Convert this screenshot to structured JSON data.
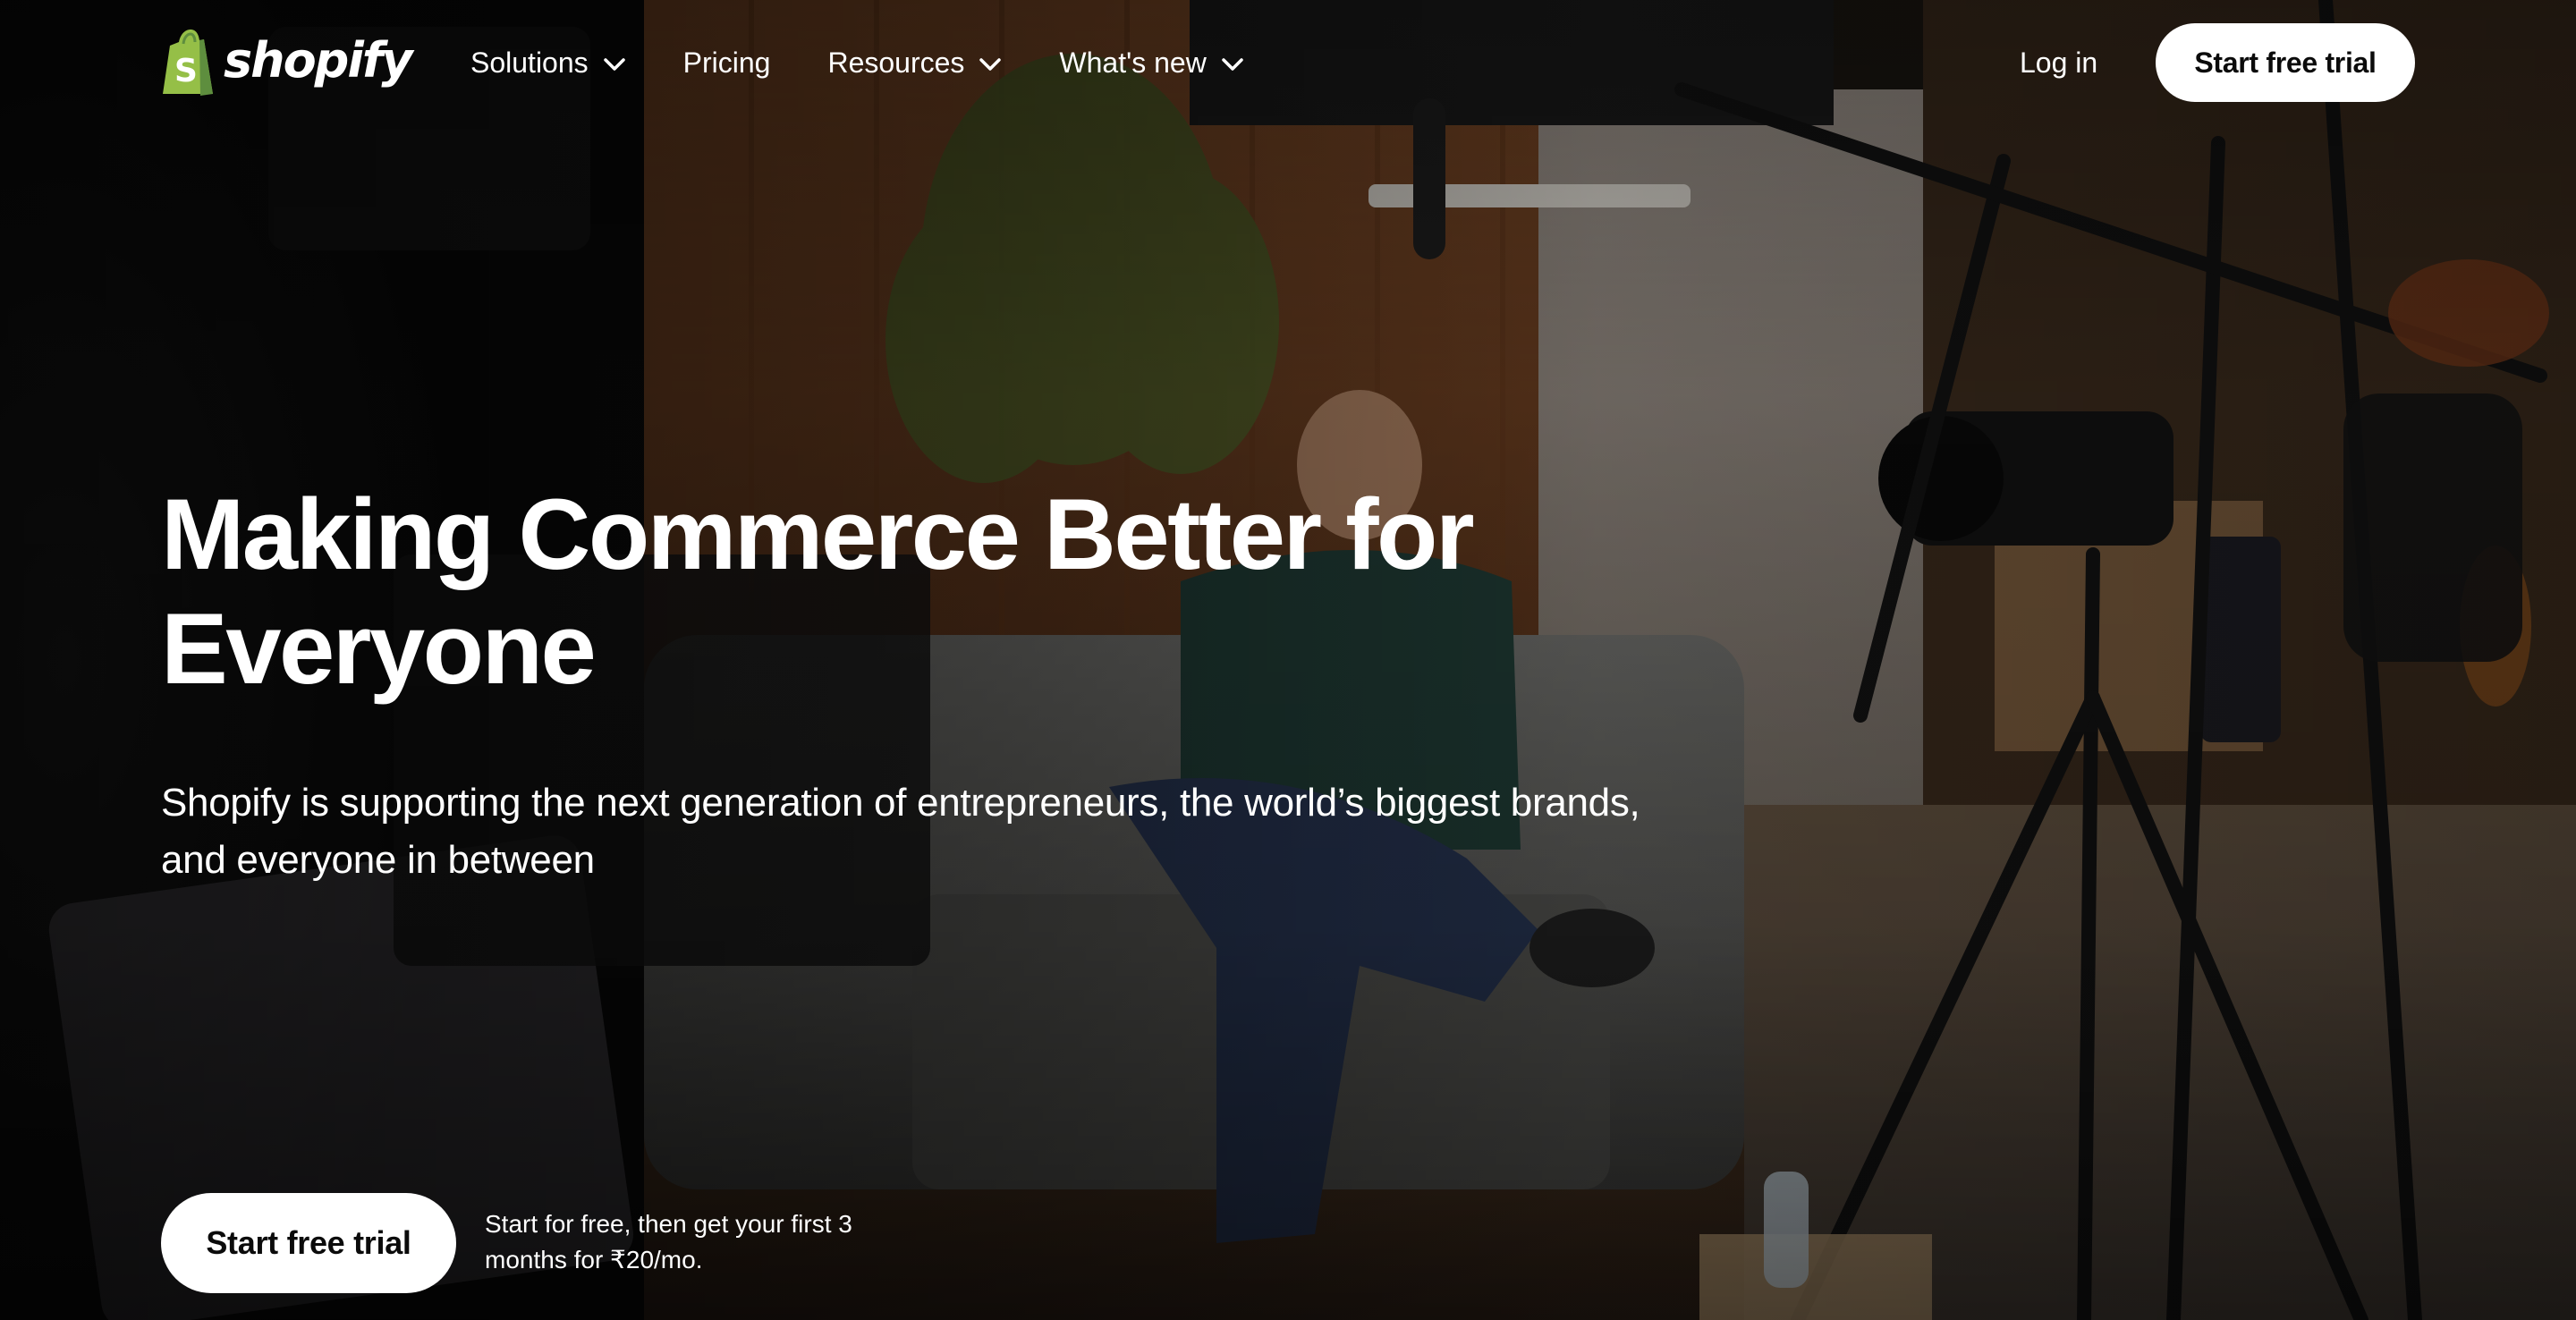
{
  "brand": {
    "logo_text": "shopify",
    "logo_color": "#95BF47",
    "logo_dark_color": "#5E8E3E"
  },
  "nav": {
    "items": [
      {
        "label": "Solutions",
        "has_dropdown": true,
        "icon": "chevron-down-icon"
      },
      {
        "label": "Pricing",
        "has_dropdown": false
      },
      {
        "label": "Resources",
        "has_dropdown": true,
        "icon": "chevron-down-icon"
      },
      {
        "label": "What's new",
        "has_dropdown": true,
        "icon": "chevron-down-icon"
      }
    ],
    "login_label": "Log in",
    "cta_label": "Start free trial"
  },
  "hero": {
    "title": "Making Commerce Better for Everyone",
    "subtitle": "Shopify is supporting the next generation of entrepreneurs, the world’s biggest brands, and everyone in between",
    "cta_label": "Start free trial",
    "cta_note": "Start for free, then get your first 3 months for ₹20/mo.",
    "background": "video still of a man seated on a grey sofa in a studio surrounded by cameras and lights"
  },
  "colors": {
    "text": "#FFFFFF",
    "button_bg": "#FFFFFF",
    "button_text": "#0B0B0B"
  }
}
